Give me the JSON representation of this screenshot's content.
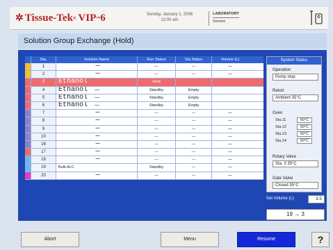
{
  "header": {
    "brand": "Tissue-Tek",
    "model": "VIP",
    "model_num": "6",
    "date": "Sunday, January 1, 2006",
    "time": "12:00 am",
    "mode": "LABORATORY",
    "submode": "Service",
    "colors": {
      "brand": "#b4222a"
    }
  },
  "page": {
    "title": "Solution Group Exchange (Hold)"
  },
  "table": {
    "headers": {
      "sta": "Sta.",
      "name": "Solution Name",
      "run": "Run Status",
      "sstat": "Sta.Status",
      "vol": "Volume (L)"
    },
    "rows": [
      {
        "sta": "1",
        "name": "—",
        "run": "—",
        "sstat": "—",
        "vol": "—",
        "color": "#f2c12e",
        "hold": false
      },
      {
        "sta": "2",
        "name": "—",
        "run": "—",
        "sstat": "—",
        "vol": "—",
        "color": "#f2c12e",
        "hold": false
      },
      {
        "sta": "3",
        "name": "Ethanol",
        "run": "Hold",
        "sstat": "",
        "vol": "",
        "color": "#ee6b6e",
        "hold": true
      },
      {
        "sta": "4",
        "name": "Ethanol",
        "run": "Standby",
        "sstat": "Empty",
        "vol": "",
        "color": "#ee6b6e",
        "hold": false,
        "dash": "—"
      },
      {
        "sta": "5",
        "name": "Ethanol",
        "run": "Standby",
        "sstat": "Empty",
        "vol": "",
        "color": "#ee6b6e",
        "hold": false,
        "dash": "—"
      },
      {
        "sta": "6",
        "name": "Ethanol",
        "run": "Standby",
        "sstat": "Empty",
        "vol": "",
        "color": "#ee6b6e",
        "hold": false,
        "dash": "—"
      },
      {
        "sta": "7",
        "name": "—",
        "run": "—",
        "sstat": "—",
        "vol": "—",
        "color": "#8d82c8",
        "hold": false
      },
      {
        "sta": "8",
        "name": "—",
        "run": "—",
        "sstat": "—",
        "vol": "—",
        "color": "#8d82c8",
        "hold": false
      },
      {
        "sta": "9",
        "name": "—",
        "run": "—",
        "sstat": "—",
        "vol": "—",
        "color": "#8d82c8",
        "hold": false
      },
      {
        "sta": "10",
        "name": "—",
        "run": "—",
        "sstat": "—",
        "vol": "—",
        "color": "#8d82c8",
        "hold": false
      },
      {
        "sta": "16",
        "name": "—",
        "run": "—",
        "sstat": "—",
        "vol": "—",
        "color": "#8d82c8",
        "hold": false
      },
      {
        "sta": "17",
        "name": "—",
        "run": "—",
        "sstat": "—",
        "vol": "—",
        "color": "#ee6b6e",
        "hold": false
      },
      {
        "sta": "18",
        "name": "—",
        "run": "—",
        "sstat": "—",
        "vol": "—",
        "color": "#6fb6f0",
        "hold": false
      },
      {
        "sta": "19",
        "name": "Bulk ALC",
        "run": "Standby",
        "sstat": "—",
        "vol": "—",
        "color": "#6fb6f0",
        "hold": false,
        "small": true
      },
      {
        "sta": "20",
        "name": "—",
        "run": "—",
        "sstat": "—",
        "vol": "—",
        "color": "#e838c6",
        "hold": false
      }
    ]
  },
  "status": {
    "title": "System Status",
    "operation_label": "Operation",
    "operation_value": "Pump stop",
    "retort_label": "Retort",
    "retort_value": "Ambient 35°C",
    "oven_label": "Oven",
    "oven": [
      {
        "label": "Sta.11",
        "value": "60°C"
      },
      {
        "label": "Sta.12",
        "value": "60°C"
      },
      {
        "label": "Sta.13",
        "value": "60°C"
      },
      {
        "label": "Sta.14",
        "value": "60°C"
      }
    ],
    "rotary_label": "Rotary Valve",
    "rotary_value": "Sta. 3 35°C",
    "gate_label": "Gate Valve",
    "gate_value": "Closed 35°C"
  },
  "set_volume": {
    "label": "Set Volume (L)",
    "value": "3.5"
  },
  "exchange": {
    "text": "19 → 3"
  },
  "buttons": {
    "abort": "Abort",
    "menu": "Menu",
    "resume": "Resume",
    "help": "?"
  }
}
